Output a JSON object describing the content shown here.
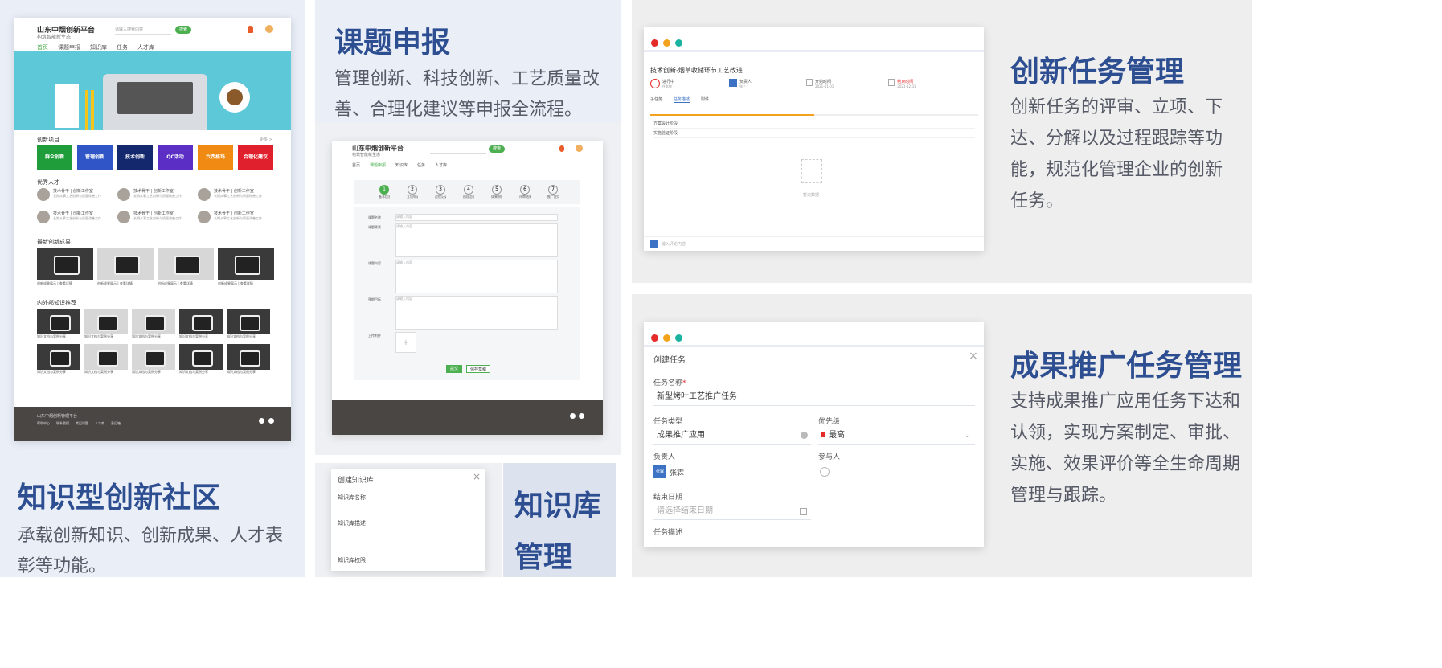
{
  "sections": {
    "community": {
      "title": "知识型创新社区",
      "desc": "承载创新知识、创新成果、人才表彰等功能。"
    },
    "topic": {
      "title": "课题申报",
      "desc": "管理创新、科技创新、工艺质量改善、合理化建议等申报全流程。"
    },
    "kb": {
      "title_line1": "知识库",
      "title_line2": "管理"
    },
    "task": {
      "title": "创新任务管理",
      "desc": "创新任务的评审、立项、下达、分解以及过程跟踪等功能，规范化管理企业的创新任务。"
    },
    "promo": {
      "title": "成果推广任务管理",
      "desc": "支持成果推广应用任务下达和认领，实现方案制定、审批、实施、效果评价等全生命周期管理与跟踪。"
    }
  },
  "portal": {
    "logo_line1": "山东中烟创新平台",
    "logo_line2": "构筑智能新生态",
    "search_btn": "搜索",
    "search_placeholder": "请输入搜索内容",
    "nav": [
      "首页",
      "课题申报",
      "知识库",
      "任务",
      "人才库"
    ],
    "sec_projects": "创新项目",
    "more": "更多 >",
    "projects": [
      {
        "label": "群众创新",
        "color": "#1f9d3a"
      },
      {
        "label": "管理创新",
        "color": "#2f55c6"
      },
      {
        "label": "技术创新",
        "color": "#14286d"
      },
      {
        "label": "QC活动",
        "color": "#5b2fc6"
      },
      {
        "label": "六西格玛",
        "color": "#f08a12"
      },
      {
        "label": "合理化建议",
        "color": "#e0202c"
      }
    ],
    "sec_talent": "优秀人才",
    "talent_name": "技术骨干 | 创新工作室",
    "talent_desc": "长期从事工艺创新与质量改善工作",
    "sec_results": "最新创新成果",
    "result_caption": "创新成果展示 | 查看详情",
    "sec_knowledge": "内外部知识推荐",
    "knowledge_caption": "知识文档与案例分享",
    "footer_text": "山东中烟创新管理平台",
    "footer_links": [
      "帮助中心",
      "联系我们",
      "常见问题",
      "人才库",
      "意见箱"
    ]
  },
  "topic_form": {
    "logo_line1": "山东中烟创新平台",
    "logo_line2": "构筑智能新生态",
    "search_btn": "搜索",
    "nav": [
      "首页",
      "课题申报",
      "知识库",
      "任务",
      "人才库"
    ],
    "steps": [
      "1",
      "2",
      "3",
      "4",
      "5",
      "6",
      "7"
    ],
    "step_labels": [
      "基本信息",
      "立项申请",
      "过程记录",
      "阶段总结",
      "成果申报",
      "评审结果",
      "推广应用"
    ],
    "labels": [
      "课题名称",
      "课题背景",
      "课题内容",
      "预期目标",
      "上传附件"
    ],
    "placeholder": "请输入内容",
    "submit_btn": "提交",
    "draft_btn": "保存草稿"
  },
  "kb_dialog": {
    "title": "创建知识库",
    "field1": "知识库名称",
    "field2": "知识库描述",
    "field3": "知识库权限"
  },
  "task_panel": {
    "header": "技术创新-烟草收储环节工艺改进",
    "stats": [
      {
        "label": "进行中",
        "value": "任务数"
      },
      {
        "label": "负责人",
        "value": "张三"
      },
      {
        "label": "开始时间",
        "value": "2021-01-01"
      },
      {
        "label": "结束时间",
        "value": "2021-12-31"
      }
    ],
    "tabs": [
      "子任务",
      "任务描述",
      "附件"
    ],
    "rows": [
      "方案设计阶段",
      "实施验证阶段"
    ],
    "empty": "暂无数据",
    "comment_placeholder": "输入评论内容"
  },
  "promo_dialog": {
    "title": "创建任务",
    "name_label": "任务名称",
    "name_required": "*",
    "name_value": "新型烤叶工艺推广任务",
    "type_label": "任务类型",
    "type_value": "成果推广应用",
    "priority_label": "优先级",
    "priority_value": "最高",
    "owner_label": "负责人",
    "owner_value": "张霖",
    "owner_avatar": "张霖",
    "member_label": "参与人",
    "date_label": "结束日期",
    "date_placeholder": "请选择结束日期",
    "desc_label": "任务描述"
  },
  "colors": {
    "heading": "#2d4e91",
    "accent_green": "#4caf50",
    "banner": "#5cc8d8"
  },
  "icons": [
    "close-icon",
    "calendar-icon",
    "user-add-icon",
    "chevron-down-icon",
    "flag-icon",
    "clear-icon"
  ]
}
